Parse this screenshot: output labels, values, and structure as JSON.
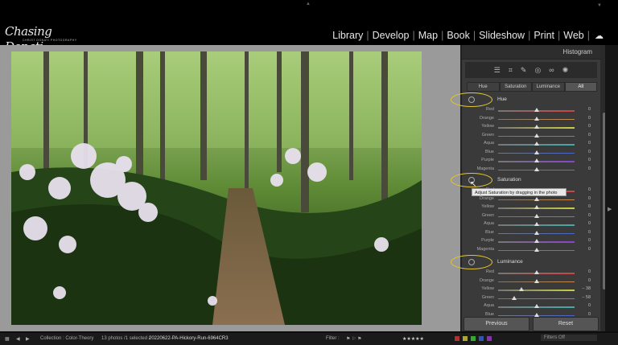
{
  "logo": {
    "signature": "Chasing Donati",
    "tagline": "CHRIST DONATI PHOTOGRAPHY"
  },
  "modules": [
    "Library",
    "Develop",
    "Map",
    "Book",
    "Slideshow",
    "Print",
    "Web"
  ],
  "panel": {
    "header": "Histogram",
    "tabs": [
      "Hue",
      "Saturation",
      "Luminance",
      "All"
    ],
    "active_tab": "All",
    "sections": {
      "hue": {
        "title": "Hue",
        "rows": [
          {
            "label": "Red",
            "value": "0",
            "level": 0.5,
            "color": "#c44"
          },
          {
            "label": "Orange",
            "value": "0",
            "level": 0.5,
            "color": "#c84"
          },
          {
            "label": "Yellow",
            "value": "0",
            "level": 0.5,
            "color": "#cc4"
          },
          {
            "label": "Green",
            "value": "0",
            "level": 0.5,
            "color": "#4a4"
          },
          {
            "label": "Aqua",
            "value": "0",
            "level": 0.5,
            "color": "#4aa"
          },
          {
            "label": "Blue",
            "value": "0",
            "level": 0.5,
            "color": "#46c"
          },
          {
            "label": "Purple",
            "value": "0",
            "level": 0.5,
            "color": "#84c"
          },
          {
            "label": "Magenta",
            "value": "0",
            "level": 0.5,
            "color": "#c4a"
          }
        ]
      },
      "saturation": {
        "title": "Saturation",
        "tooltip": "Adjust Saturation by dragging in the photo",
        "rows": [
          {
            "label": "Red",
            "value": "0",
            "level": 0.5,
            "color": "#c44"
          },
          {
            "label": "Orange",
            "value": "0",
            "level": 0.5,
            "color": "#c84"
          },
          {
            "label": "Yellow",
            "value": "0",
            "level": 0.5,
            "color": "#cc4"
          },
          {
            "label": "Green",
            "value": "0",
            "level": 0.5,
            "color": "#4a4"
          },
          {
            "label": "Aqua",
            "value": "0",
            "level": 0.5,
            "color": "#4aa"
          },
          {
            "label": "Blue",
            "value": "0",
            "level": 0.5,
            "color": "#46c"
          },
          {
            "label": "Purple",
            "value": "0",
            "level": 0.5,
            "color": "#84c"
          },
          {
            "label": "Magenta",
            "value": "0",
            "level": 0.5,
            "color": "#c4a"
          }
        ]
      },
      "luminance": {
        "title": "Luminance",
        "rows": [
          {
            "label": "Red",
            "value": "0",
            "level": 0.5,
            "color": "#c44"
          },
          {
            "label": "Orange",
            "value": "0",
            "level": 0.5,
            "color": "#c84"
          },
          {
            "label": "Yellow",
            "value": "− 38",
            "level": 0.31,
            "color": "#cc4"
          },
          {
            "label": "Green",
            "value": "− 58",
            "level": 0.21,
            "color": "#4a4"
          },
          {
            "label": "Aqua",
            "value": "0",
            "level": 0.5,
            "color": "#4aa"
          },
          {
            "label": "Blue",
            "value": "0",
            "level": 0.5,
            "color": "#46c"
          }
        ]
      }
    },
    "buttons": {
      "previous": "Previous",
      "reset": "Reset"
    }
  },
  "filmstrip": {
    "collection": "Collection : Color-Theory",
    "count": "13 photos /1 selected /",
    "filename": "20220622-PA-Hickory-Run-6964CR3",
    "filter_label": "Filter :",
    "filters_off": "Filters Off"
  },
  "colors": {
    "accent_ellipse": "#e2c72a"
  }
}
